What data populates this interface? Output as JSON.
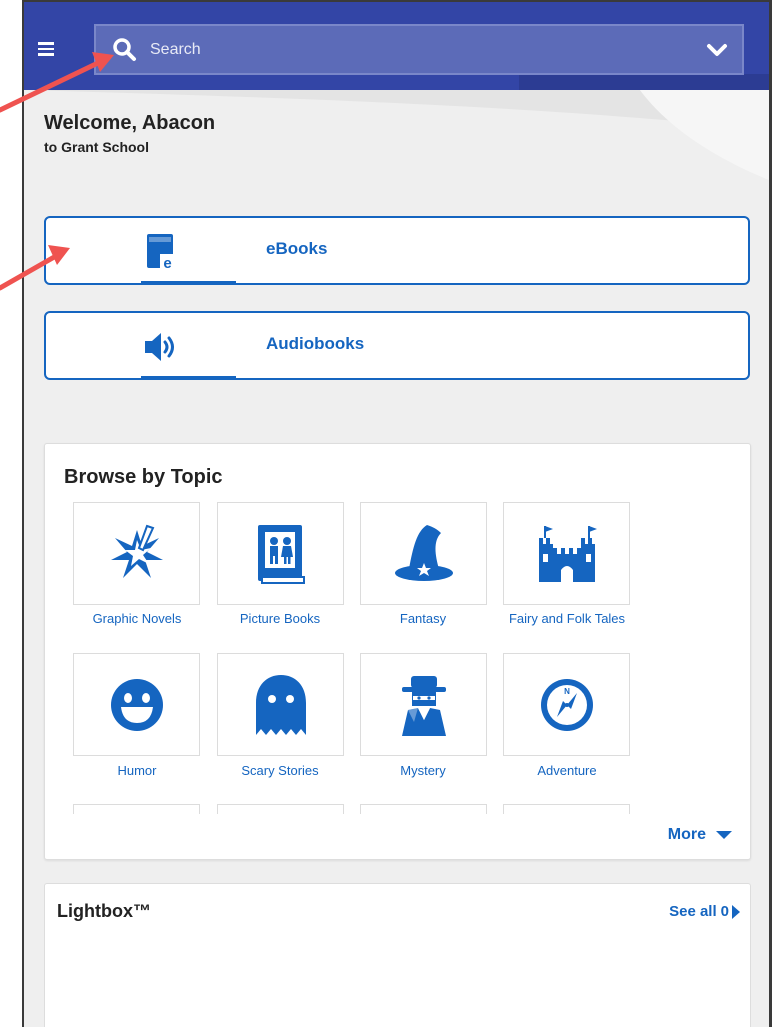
{
  "colors": {
    "topbar": "#3345a6",
    "search_bg": "#5c6bb8",
    "accent_blue": "#1565c0",
    "annotation_arrow": "#ef5350"
  },
  "search": {
    "placeholder": "Search",
    "icon": "search-icon",
    "dropdown_icon": "chevron-down-icon"
  },
  "menu": {
    "icon": "hamburger-menu-icon"
  },
  "welcome": {
    "title": "Welcome, Abacon",
    "subtitle": "to Grant School"
  },
  "media": [
    {
      "label": "eBooks",
      "icon": "ebook-icon"
    },
    {
      "label": "Audiobooks",
      "icon": "speaker-icon"
    }
  ],
  "browse": {
    "title": "Browse by Topic",
    "topics": [
      {
        "label": "Graphic Novels",
        "icon": "graphic-novels-icon"
      },
      {
        "label": "Picture Books",
        "icon": "picture-books-icon"
      },
      {
        "label": "Fantasy",
        "icon": "wizard-hat-icon"
      },
      {
        "label": "Fairy and Folk Tales",
        "icon": "castle-icon"
      },
      {
        "label": "Humor",
        "icon": "smiley-icon"
      },
      {
        "label": "Scary Stories",
        "icon": "ghost-icon"
      },
      {
        "label": "Mystery",
        "icon": "detective-icon"
      },
      {
        "label": "Adventure",
        "icon": "compass-icon"
      }
    ],
    "more_label": "More"
  },
  "lightbox": {
    "title": "Lightbox™",
    "see_all_label": "See all",
    "count": "0"
  }
}
